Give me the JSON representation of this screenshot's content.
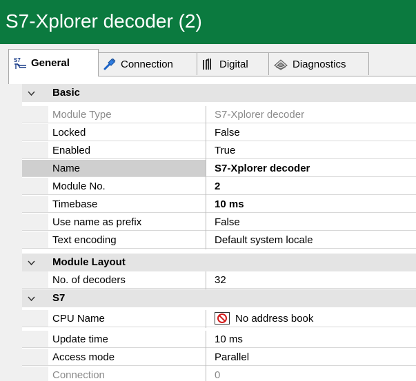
{
  "window": {
    "title": "S7-Xplorer decoder (2)",
    "colors": {
      "titlebar": "#0b7a3f",
      "grid_selected": "#cfcfcf",
      "category_bg": "#e4e4e4"
    }
  },
  "tabs": [
    {
      "label": "General",
      "icon": "s7-icon",
      "active": true
    },
    {
      "label": "Connection",
      "icon": "connection-plug-icon",
      "active": false
    },
    {
      "label": "Digital",
      "icon": "digital-signal-icon",
      "active": false
    },
    {
      "label": "Diagnostics",
      "icon": "diagnostics-icon",
      "active": false
    }
  ],
  "categories": {
    "basic": {
      "label": "Basic",
      "rows": [
        {
          "name": "Module Type",
          "value": "S7-Xplorer decoder"
        },
        {
          "name": "Locked",
          "value": "False"
        },
        {
          "name": "Enabled",
          "value": "True"
        },
        {
          "name": "Name",
          "value": "S7-Xplorer decoder"
        },
        {
          "name": "Module No.",
          "value": "2"
        },
        {
          "name": "Timebase",
          "value": "10 ms"
        },
        {
          "name": "Use name as prefix",
          "value": "False"
        },
        {
          "name": "Text encoding",
          "value": "Default system locale"
        }
      ]
    },
    "module_layout": {
      "label": "Module Layout",
      "rows": [
        {
          "name": "No. of decoders",
          "value": "32"
        }
      ]
    },
    "s7": {
      "label": "S7",
      "rows": [
        {
          "name": "CPU Name",
          "value": "No address book",
          "icon": "no-entry-icon"
        },
        {
          "name": "Update time",
          "value": "10 ms"
        },
        {
          "name": "Access mode",
          "value": "Parallel"
        },
        {
          "name": "Connection",
          "value": "0"
        }
      ]
    }
  }
}
